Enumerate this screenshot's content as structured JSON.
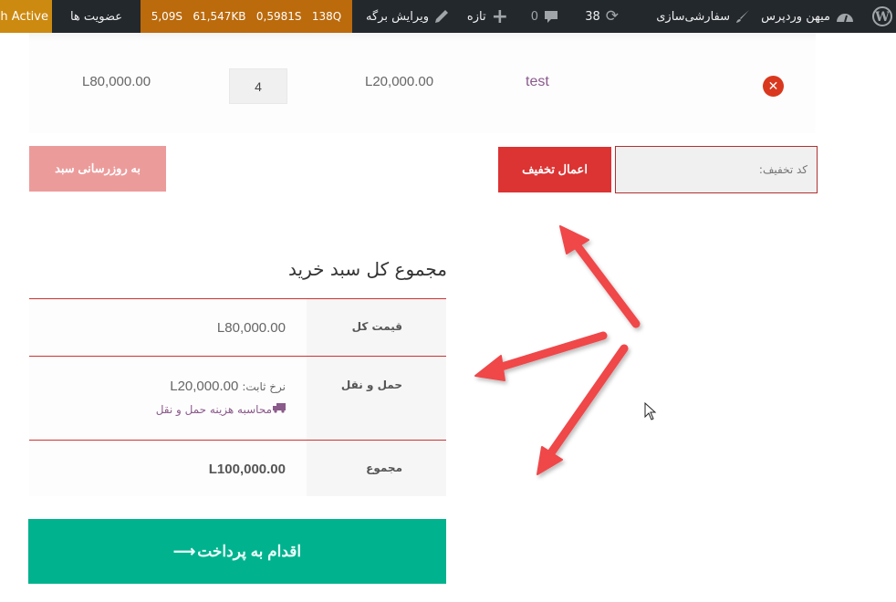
{
  "admin_bar": {
    "wp_logo": "wordpress-logo",
    "site_name": "میهن وردپرس",
    "customize": "سفارشی‌سازی",
    "updates_count": "38",
    "comments_count": "0",
    "new_label": "تازه",
    "edit_page": "ویرایش برگه",
    "perf": {
      "queries": "138Q",
      "query_time": "0,5981S",
      "memory": "61,547KB",
      "page_time": "5,09S"
    },
    "members": "عضویت ها",
    "active_label": "h Active"
  },
  "cart_item": {
    "product_name": "test",
    "price": "L20,000.00",
    "quantity": "4",
    "subtotal": "L80,000.00"
  },
  "coupon": {
    "placeholder": "کد تخفیف:",
    "apply_label": "اعمال تخفیف",
    "update_cart_label": "به روزرسانی سبد"
  },
  "totals": {
    "title": "مجموع کل سبد خرید",
    "subtotal_label": "قیمت کل",
    "subtotal_value": "L80,000.00",
    "shipping_label": "حمل و نقل",
    "shipping_rate_prefix": "نرخ ثابت:",
    "shipping_rate_value": "L20,000.00",
    "shipping_calc_link": "محاسبه هزینه حمل و نقل",
    "total_label": "مجموع",
    "total_value": "L100,000.00",
    "checkout_label": "اقدام به پرداخت",
    "checkout_arrow": "⟶"
  },
  "colors": {
    "admin_bar_bg": "#23282d",
    "perf_bg": "#bb6a0c",
    "active_bg": "#cd8a10",
    "apply_btn": "#dc3333",
    "update_btn": "#ec9b9b",
    "checkout_btn": "#00b28e",
    "link_purple": "#8a5a8a",
    "remove_red": "#d9381e",
    "annotation_arrow": "#f0474a"
  }
}
